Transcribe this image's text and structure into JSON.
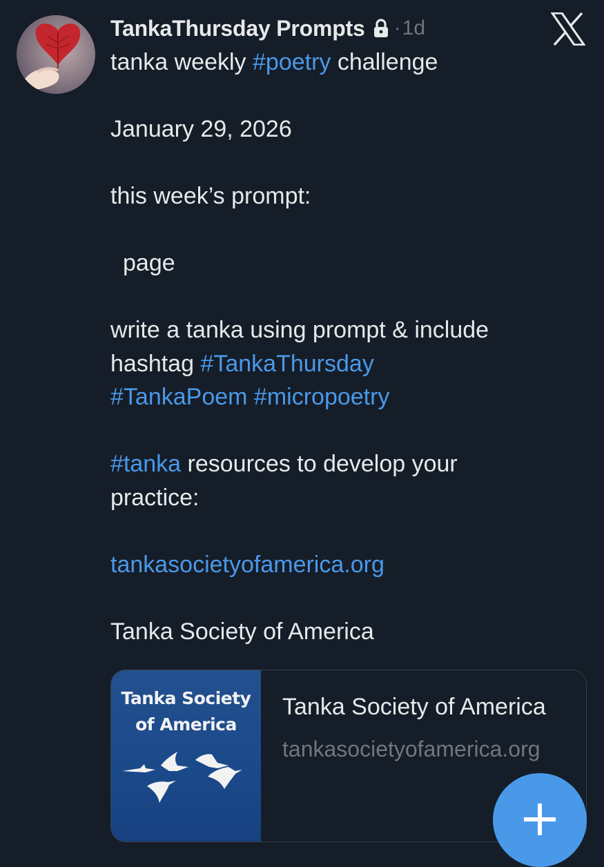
{
  "post": {
    "author_name": "TankaThursday Prompts",
    "separator": "·",
    "age": "1d",
    "lines": {
      "line1_prefix": "tanka weekly ",
      "line1_tag": "#poetry",
      "line1_suffix": " challenge",
      "date": "January 29, 2026",
      "prompt_label": "this week’s prompt:",
      "prompt_word": "page",
      "instruction": "write a tanka using prompt & include",
      "hashtag_label": "hashtag ",
      "tag_tankathursday": "#TankaThursday",
      "tag_tankapoem": "#TankaPoem",
      "tag_micropoetry": "#micropoetry",
      "tag_tanka": "#tanka",
      "resources_text": " resources to develop your",
      "resources_text2": "practice:",
      "link_url": "tankasocietyofamerica.org",
      "org_name": "Tanka Society of America"
    }
  },
  "link_card": {
    "thumb_line1": "Tanka Society",
    "thumb_line2": "of America",
    "title": "Tanka Society of America",
    "domain": "tankasocietyofamerica.org"
  },
  "icons": {
    "lock": "lock-icon",
    "logo": "x-logo-icon",
    "fab": "plus-icon"
  },
  "colors": {
    "background": "#151d28",
    "text": "#e7e9ea",
    "muted": "#71767b",
    "link": "#4a99e9",
    "card_border": "#38444d",
    "fab": "#4a99e9"
  }
}
